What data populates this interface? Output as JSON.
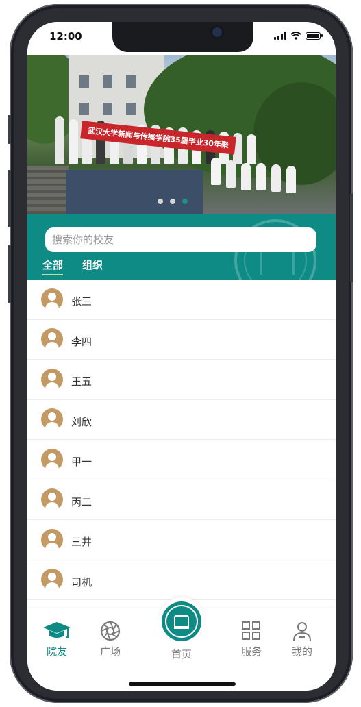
{
  "status_bar": {
    "time": "12:00"
  },
  "banner": {
    "sign_text": "武汉大学新闻与传播学院35届毕业30年聚",
    "slide_count": 3,
    "active_slide": 3
  },
  "search": {
    "placeholder": "搜索你的校友",
    "value": ""
  },
  "filter_tabs": [
    {
      "label": "全部",
      "active": true
    },
    {
      "label": "组织",
      "active": false
    }
  ],
  "contacts": [
    {
      "name": "张三"
    },
    {
      "name": "李四"
    },
    {
      "name": "王五"
    },
    {
      "name": "刘欣"
    },
    {
      "name": "甲一"
    },
    {
      "name": "丙二"
    },
    {
      "name": "三井"
    },
    {
      "name": "司机"
    }
  ],
  "bottom_nav": {
    "alumni": {
      "label": "院友",
      "icon": "graduation-cap-icon",
      "active": true
    },
    "square": {
      "label": "广场",
      "icon": "aperture-icon",
      "active": false
    },
    "home": {
      "label": "首页",
      "icon": "school-seal-logo",
      "active": false
    },
    "services": {
      "label": "服务",
      "icon": "grid-icon",
      "active": false
    },
    "mine": {
      "label": "我的",
      "icon": "person-icon",
      "active": false
    }
  },
  "colors": {
    "accent": "#0f8b86",
    "avatar": "#c49a64",
    "inactive": "#7a7a7a"
  }
}
